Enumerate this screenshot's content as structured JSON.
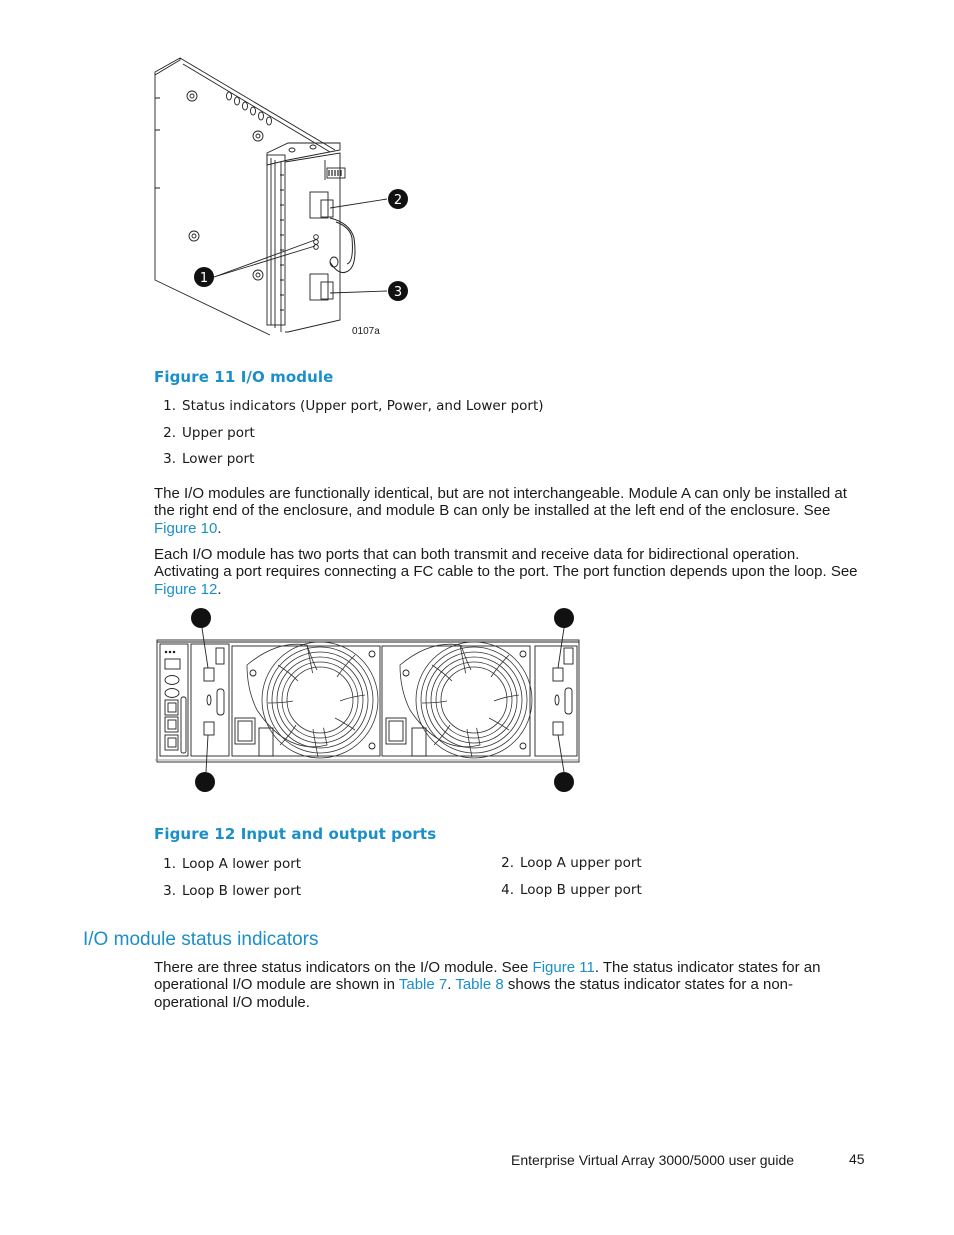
{
  "figure11": {
    "image_id_label": "0107a",
    "callouts": [
      "1",
      "2",
      "3"
    ],
    "caption": "Figure 11 I/O module",
    "items": [
      {
        "num": "1.",
        "text": "Status indicators (Upper port, Power, and Lower port)"
      },
      {
        "num": "2.",
        "text": "Upper port"
      },
      {
        "num": "3.",
        "text": "Lower port"
      }
    ]
  },
  "paragraph1": {
    "text": "The I/O modules are functionally identical, but are not interchangeable.  Module A can only be installed at the right end of the enclosure, and module B can only be installed at the left end of the enclosure.  See ",
    "link": "Figure 10",
    "after": "."
  },
  "paragraph2": {
    "text": "Each I/O module has two ports that can both transmit and receive data for bidirectional operation.  Activating a port requires connecting a FC cable to the port.  The port function depends upon the loop.  See ",
    "link": "Figure 12",
    "after": "."
  },
  "figure12": {
    "caption": "Figure 12 Input and output ports",
    "items": [
      {
        "num": "1.",
        "text": "Loop A lower port"
      },
      {
        "num": "2.",
        "text": "Loop A upper port"
      },
      {
        "num": "3.",
        "text": "Loop B lower port"
      },
      {
        "num": "4.",
        "text": "Loop B upper port"
      }
    ]
  },
  "section": {
    "heading": "I/O module status indicators",
    "text1": "There are three status indicators on the I/O module.  See ",
    "link1": "Figure 11",
    "text2": ".  The status indicator states for an operational I/O module are shown in ",
    "link2": "Table 7",
    "text3": ".  ",
    "link3": "Table 8",
    "text4": " shows the status indicator states for a non-operational I/O module."
  },
  "footer": {
    "guide_title": "Enterprise Virtual Array 3000/5000 user guide",
    "page_number": "45"
  },
  "colors": {
    "accent": "#1a8fc9",
    "text": "#1a1a1a"
  }
}
